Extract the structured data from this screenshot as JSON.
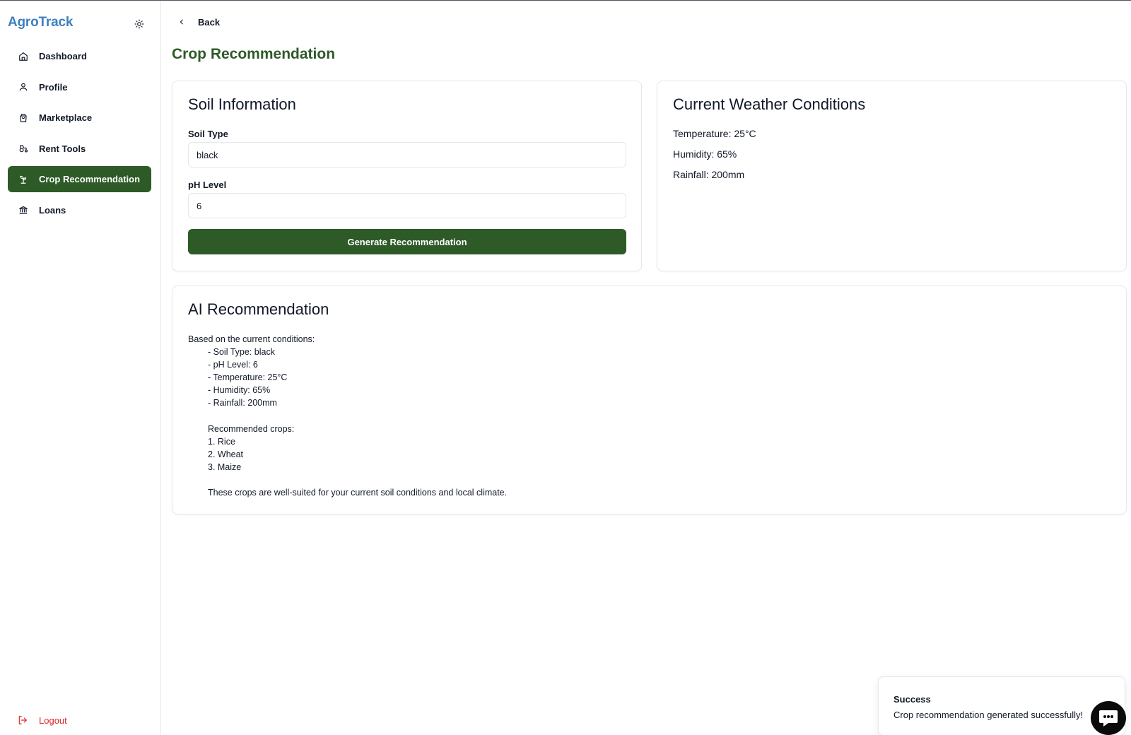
{
  "app": {
    "brand": "AgroTrack"
  },
  "colors": {
    "brand": "#3f7fbf",
    "primary": "#2d5a27",
    "danger": "#dc2626",
    "border": "#e5e7eb"
  },
  "sidebar": {
    "items": [
      {
        "label": "Dashboard",
        "icon": "home-icon",
        "active": false
      },
      {
        "label": "Profile",
        "icon": "user-icon",
        "active": false
      },
      {
        "label": "Marketplace",
        "icon": "shopping-bag-icon",
        "active": false
      },
      {
        "label": "Rent Tools",
        "icon": "tractor-icon",
        "active": false
      },
      {
        "label": "Crop Recommendation",
        "icon": "sprout-icon",
        "active": true
      },
      {
        "label": "Loans",
        "icon": "bank-icon",
        "active": false
      }
    ],
    "logout_label": "Logout"
  },
  "header": {
    "back_label": "Back",
    "title": "Crop Recommendation"
  },
  "soil": {
    "title": "Soil Information",
    "soil_type_label": "Soil Type",
    "soil_type_value": "black",
    "ph_label": "pH Level",
    "ph_value": "6",
    "button_label": "Generate Recommendation"
  },
  "weather": {
    "title": "Current Weather Conditions",
    "temperature": "Temperature: 25°C",
    "humidity": "Humidity: 65%",
    "rainfall": "Rainfall: 200mm"
  },
  "ai": {
    "title": "AI Recommendation",
    "intro": "Based on the current conditions:",
    "conditions": [
      "- Soil Type: black",
      "- pH Level: 6",
      "- Temperature: 25°C",
      "- Humidity: 65%",
      "- Rainfall: 200mm"
    ],
    "crops_heading": "Recommended crops:",
    "crops": [
      "1. Rice",
      "2. Wheat",
      "3. Maize"
    ],
    "closing": "These crops are well-suited for your current soil conditions and local climate."
  },
  "toast": {
    "title": "Success",
    "message": "Crop recommendation generated successfully!"
  }
}
